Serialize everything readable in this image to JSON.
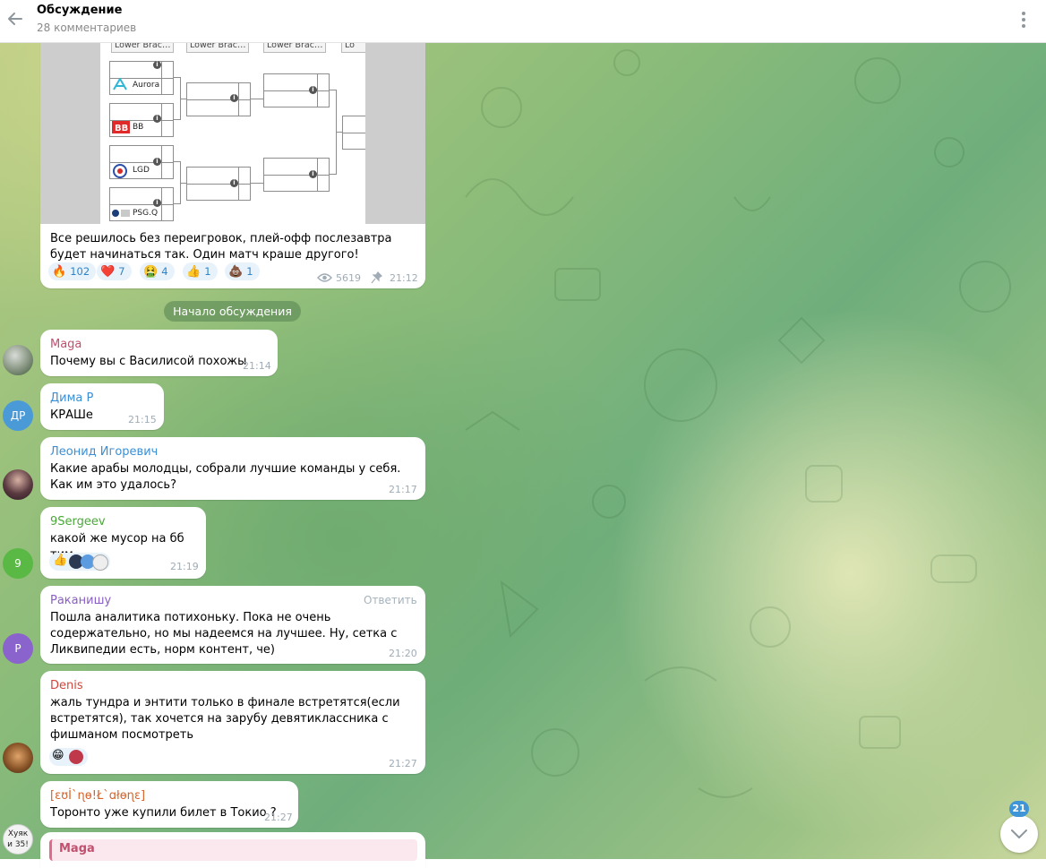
{
  "header": {
    "title": "Обсуждение",
    "subtitle": "28 комментариев",
    "back_icon": "arrow-left-icon",
    "more_icon": "kebab-menu-icon"
  },
  "post": {
    "bracket_headers": [
      "Lower Brac…",
      "Lower Brac…",
      "Lower Brac…",
      "Lo"
    ],
    "teams": [
      "Aurora",
      "BB",
      "LGD",
      "PSG.Q"
    ],
    "text": "Все решилось без переигровок, плей-офф послезавтра будет начинаться так. Один матч краше другого!",
    "reactions": [
      {
        "emoji": "🔥",
        "count": "102"
      },
      {
        "emoji": "❤️",
        "count": "7"
      },
      {
        "emoji": "🤮",
        "count": "4"
      },
      {
        "emoji": "👍",
        "count": "1"
      },
      {
        "emoji": "💩",
        "count": "1"
      }
    ],
    "views": "5619",
    "time": "21:12"
  },
  "discussion_start": "Начало обсуждения",
  "comments": [
    {
      "name": "Maga",
      "text": "Почему вы с Василисой похожы",
      "time": "21:14",
      "name_color": "#c0506e"
    },
    {
      "name": "Дима Р",
      "avatar": "ДР",
      "text": "КРАШе",
      "time": "21:15",
      "name_color": "#3a8fd6"
    },
    {
      "name": "Леонид Игоревич",
      "text": "Какие арабы молодцы, собрали лучшие команды у себя. Как им это удалось?",
      "time": "21:17",
      "name_color": "#3a8fd6"
    },
    {
      "name": "9Sergeev",
      "avatar": "9",
      "text": "какой же мусор на бб тим",
      "time": "21:19",
      "name_color": "#4aa838"
    },
    {
      "name": "Раканишу",
      "avatar": "Р",
      "text": "Пошла аналитика потихоньку. Пока не очень содержательно, но мы надеемся на лучшее. Ну, сетка с Ликвипедии есть, норм контент, че)",
      "time": "21:20",
      "reply": "Ответить",
      "name_color": "#8a5ec5"
    },
    {
      "name": "Denis",
      "text": "жаль тундра и энтити только в финале встретятся(если встретятся), так хочется на зарубу девятиклассника с фишманом посмотреть",
      "time": "21:27",
      "name_color": "#d4453b"
    },
    {
      "name": "[ɛʊİ`ɳɵ!Ł`ɑłɵɳɛ]",
      "text": "Торонто уже купили билет в Токио ?",
      "time": "21:27",
      "name_color": "#d4632b"
    },
    {
      "name": "Maga",
      "name_color": "#c0506e"
    }
  ],
  "scroll": {
    "unread": "21",
    "icon": "chevron-down-icon"
  }
}
